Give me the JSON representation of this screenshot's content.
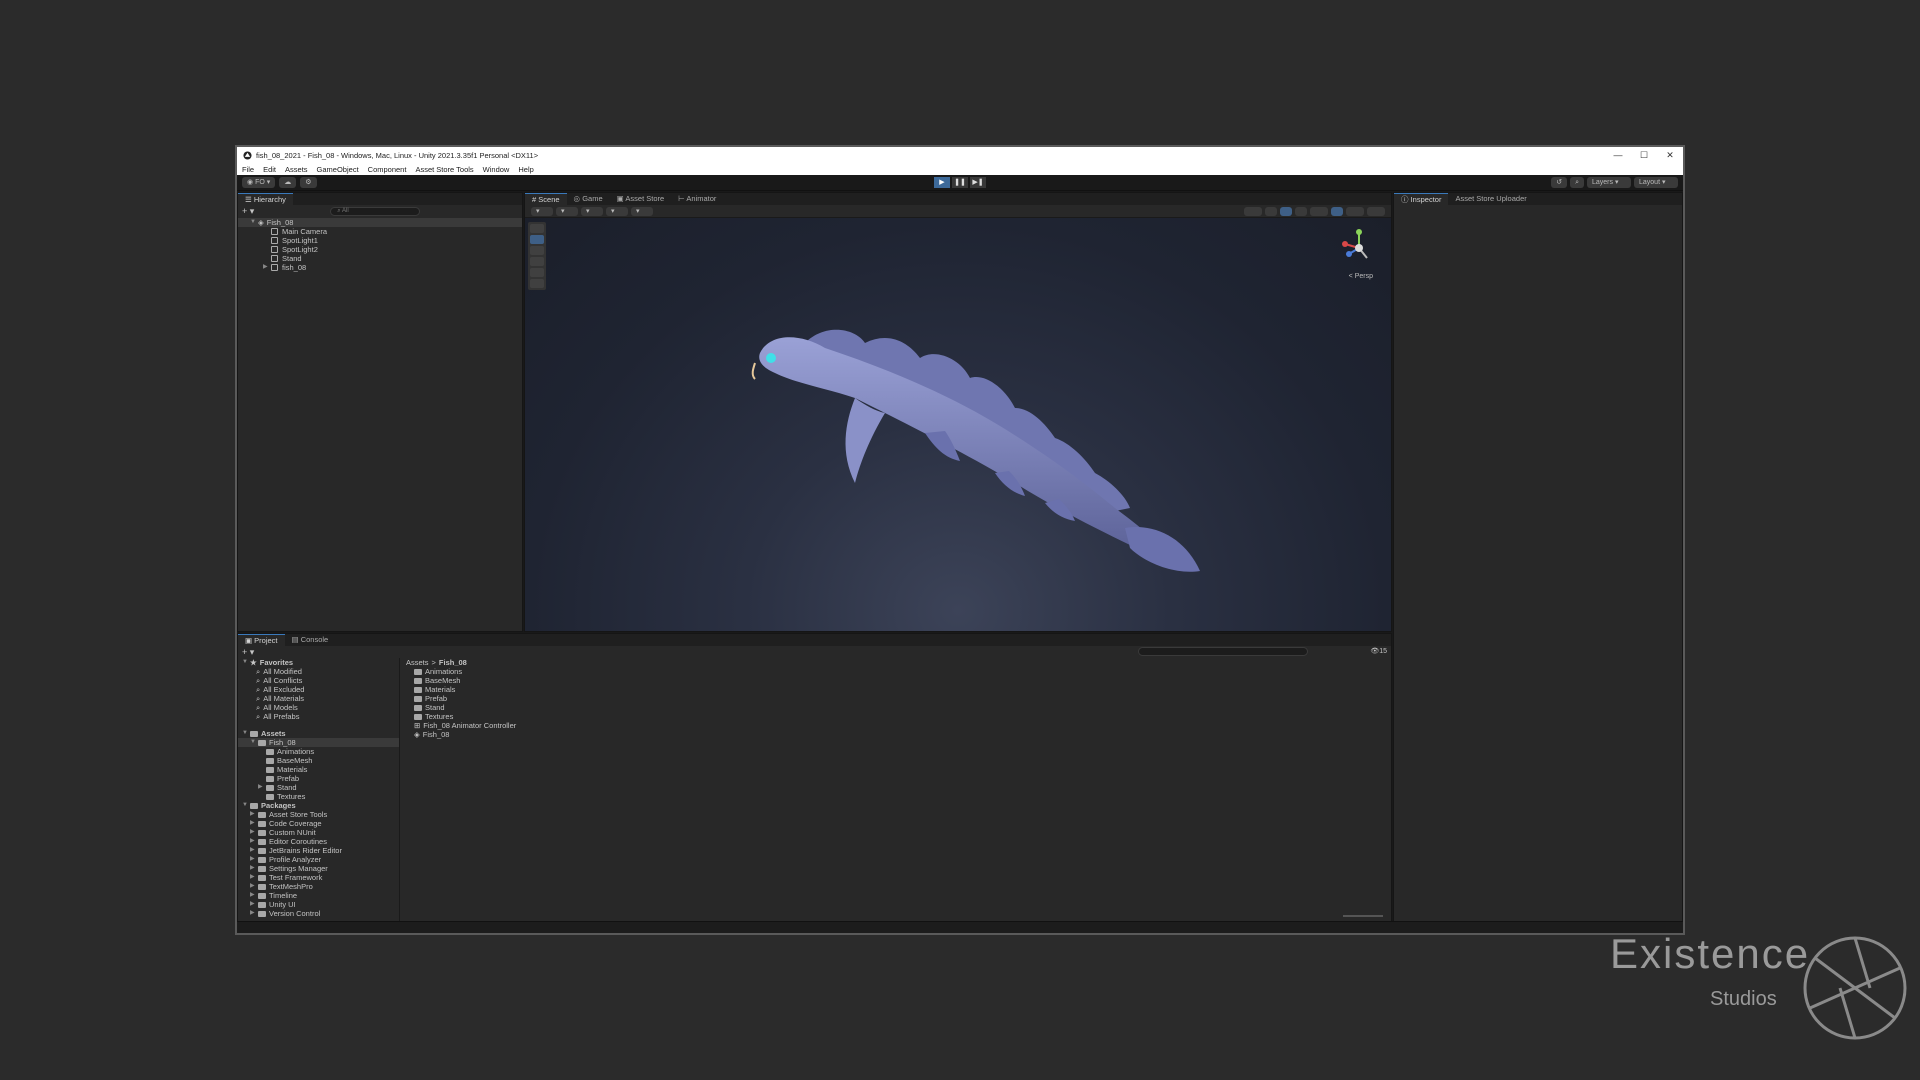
{
  "window": {
    "title": "fish_08_2021 - Fish_08 - Windows, Mac, Linux - Unity 2021.3.35f1 Personal <DX11>",
    "controls": [
      "—",
      "☐",
      "✕"
    ]
  },
  "menu": [
    "File",
    "Edit",
    "Assets",
    "GameObject",
    "Component",
    "Asset Store Tools",
    "Window",
    "Help"
  ],
  "toolbar": {
    "account": "FO",
    "layers": "Layers",
    "layout": "Layout"
  },
  "hierarchy": {
    "tab": "Hierarchy",
    "search_placeholder": "All",
    "scene": "Fish_08",
    "items": [
      "Main Camera",
      "SpotLight1",
      "SpotLight2",
      "Stand",
      "fish_08"
    ]
  },
  "center_tabs": [
    "Scene",
    "Game",
    "Asset Store",
    "Animator"
  ],
  "scene": {
    "persp_label": "< Persp"
  },
  "inspector_tabs": [
    "Inspector",
    "Asset Store Uploader"
  ],
  "bottom_tabs": [
    "Project",
    "Console"
  ],
  "project": {
    "favorites_label": "Favorites",
    "favorites": [
      "All Modified",
      "All Conflicts",
      "All Excluded",
      "All Materials",
      "All Models",
      "All Prefabs"
    ],
    "assets_label": "Assets",
    "fish_folder": "Fish_08",
    "fish_children": [
      "Animations",
      "BaseMesh",
      "Materials",
      "Prefab",
      "Stand",
      "Textures"
    ],
    "packages_label": "Packages",
    "packages": [
      "Asset Store Tools",
      "Code Coverage",
      "Custom NUnit",
      "Editor Coroutines",
      "JetBrains Rider Editor",
      "Profile Analyzer",
      "Settings Manager",
      "Test Framework",
      "TextMeshPro",
      "Timeline",
      "Unity UI",
      "Version Control"
    ],
    "breadcrumb": [
      "Assets",
      ">",
      "Fish_08"
    ],
    "content": [
      "Animations",
      "BaseMesh",
      "Materials",
      "Prefab",
      "Stand",
      "Textures",
      "Fish_08 Animator Controller",
      "Fish_08"
    ],
    "count": "15"
  },
  "brand": {
    "line1": "Existence",
    "line2": "Studios"
  },
  "colors": {
    "accent": "#3a79bb",
    "fish": "#7b83b8"
  }
}
